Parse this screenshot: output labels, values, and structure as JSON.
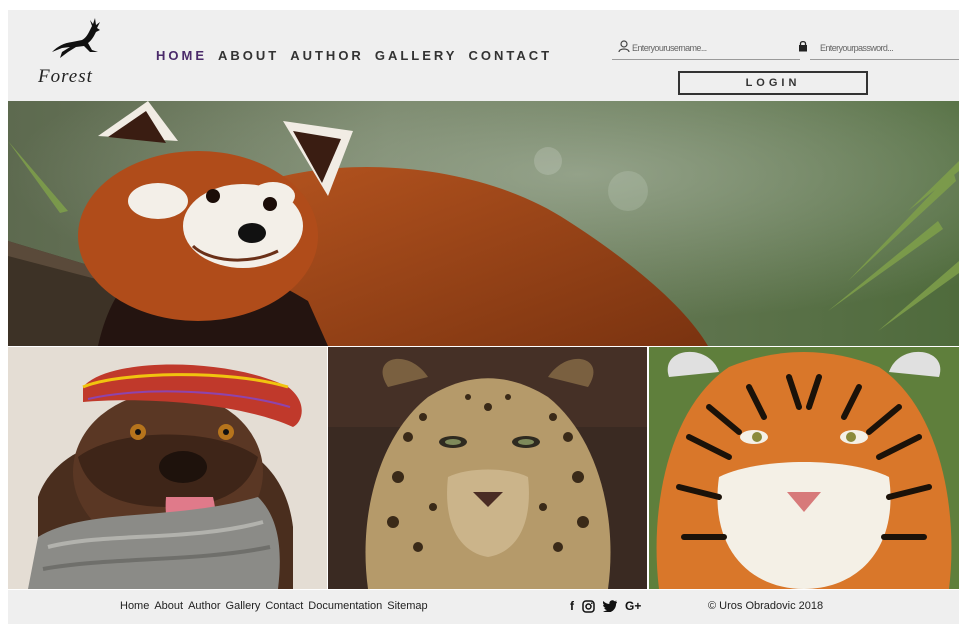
{
  "header": {
    "logo_text": "Forest",
    "nav": [
      {
        "label": "HOME"
      },
      {
        "label": "ABOUT"
      },
      {
        "label": "AUTHOR"
      },
      {
        "label": "GALLERY"
      },
      {
        "label": "CONTACT"
      }
    ],
    "login": {
      "username_placeholder": "Enteryourusername...",
      "password_placeholder": "Enteryourpassword...",
      "button_label": "LOGIN"
    }
  },
  "images": {
    "hero": "red-panda-photo",
    "gallery": [
      "dog-with-hat-photo",
      "leopard-photo",
      "tiger-photo"
    ]
  },
  "footer": {
    "links": [
      {
        "label": "Home"
      },
      {
        "label": "About"
      },
      {
        "label": "Author"
      },
      {
        "label": "Gallery"
      },
      {
        "label": "Contact"
      },
      {
        "label": "Documentation"
      },
      {
        "label": "Sitemap"
      }
    ],
    "social": {
      "facebook": "f",
      "instagram": "◎",
      "twitter": "🐦",
      "googleplus": "G+"
    },
    "copyright": "© Uros Obradovic 2018"
  },
  "colors": {
    "header_bg": "#efefef",
    "active_nav": "#4a2a6a",
    "text": "#333333"
  }
}
